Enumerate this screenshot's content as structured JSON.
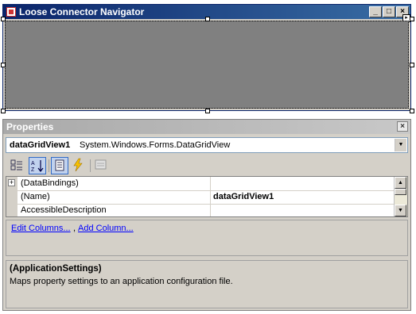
{
  "form": {
    "title": "Loose Connector Navigator",
    "min_glyph": "_",
    "max_glyph": "□",
    "close_glyph": "×",
    "smart_tag_glyph": "▸"
  },
  "properties": {
    "header": "Properties",
    "close_glyph": "×",
    "object": {
      "name": "dataGridView1",
      "type": "System.Windows.Forms.DataGridView"
    },
    "toolbar": [
      "categorized-icon",
      "alphabetical-icon",
      "properties-icon",
      "events-icon",
      "property-pages-icon"
    ],
    "rows": [
      {
        "expander": "+",
        "name": "(DataBindings)",
        "value": ""
      },
      {
        "expander": "",
        "name": "(Name)",
        "value": "dataGridView1"
      },
      {
        "expander": "",
        "name": "AccessibleDescription",
        "value": ""
      }
    ],
    "commands": {
      "edit_columns": "Edit Columns...",
      "separator": ",",
      "add_column": "Add Column..."
    },
    "description": {
      "title": "(ApplicationSettings)",
      "text": "Maps property settings to an application configuration file."
    }
  },
  "colors": {
    "title_bar": "#0a246a",
    "grid_surface": "#808080",
    "panel": "#d4d0c8",
    "link": "#0000ff"
  }
}
